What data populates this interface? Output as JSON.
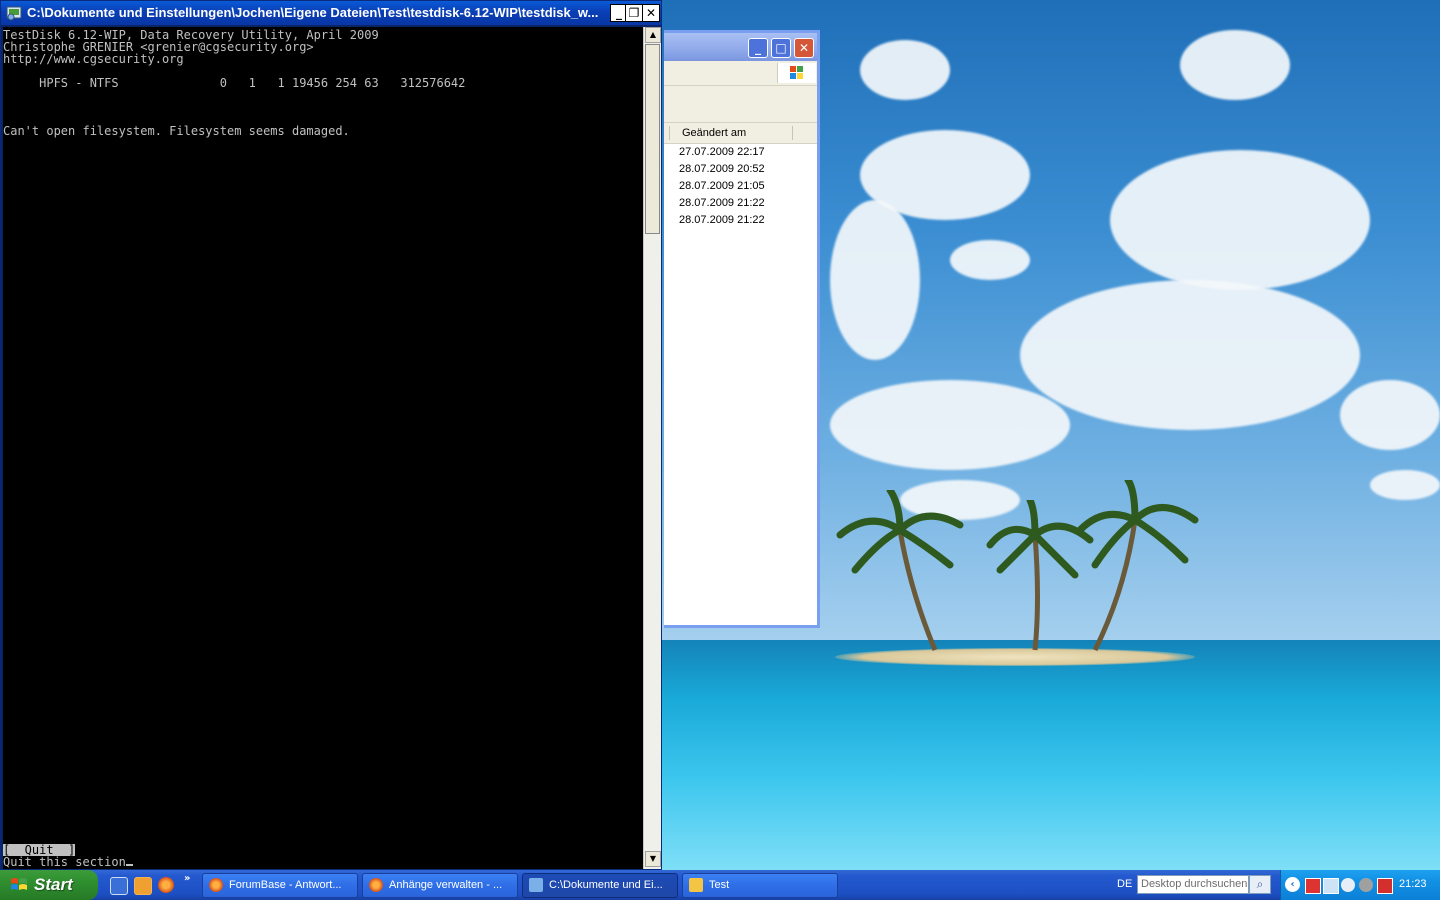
{
  "console_window": {
    "title": "C:\\Dokumente und Einstellungen\\Jochen\\Eigene Dateien\\Test\\testdisk-6.12-WIP\\testdisk_w...",
    "buttons": {
      "minimize": "_",
      "restore": "❐",
      "close": "✕"
    },
    "lines": [
      "TestDisk 6.12-WIP, Data Recovery Utility, April 2009",
      "Christophe GRENIER <grenier@cgsecurity.org>",
      "http://www.cgsecurity.org",
      "     HPFS - NTFS              0   1   1 19456 254 63   312576642",
      "Can't open filesystem. Filesystem seems damaged."
    ],
    "quit_button": "[  Quit  ]",
    "quit_description": "Quit this section"
  },
  "explorer_window": {
    "column_header": "Geändert am",
    "rows": [
      "27.07.2009 22:17",
      "28.07.2009 20:52",
      "28.07.2009 21:05",
      "28.07.2009 21:22",
      "28.07.2009 21:22"
    ]
  },
  "taskbar": {
    "start_label": "Start",
    "quick_launch_more": "»",
    "tasks": [
      {
        "label": "ForumBase - Antwort...",
        "icon_color": "#e8732a"
      },
      {
        "label": "Anhänge verwalten - ...",
        "icon_color": "#e8732a"
      },
      {
        "label": "C:\\Dokumente und Ei...",
        "icon_color": "#7ab0e8"
      },
      {
        "label": "Test",
        "icon_color": "#f4c542"
      }
    ],
    "language": "DE",
    "search_placeholder": "Desktop durchsuchen",
    "clock": "21:23"
  },
  "colors": {
    "console_bg": "#000000",
    "console_text": "#c0c0c0",
    "titlebar_blue": "#0a3fb6",
    "taskbar_blue": "#2459cf",
    "start_green": "#2f8f2f",
    "tray_blue": "#1290e4"
  }
}
